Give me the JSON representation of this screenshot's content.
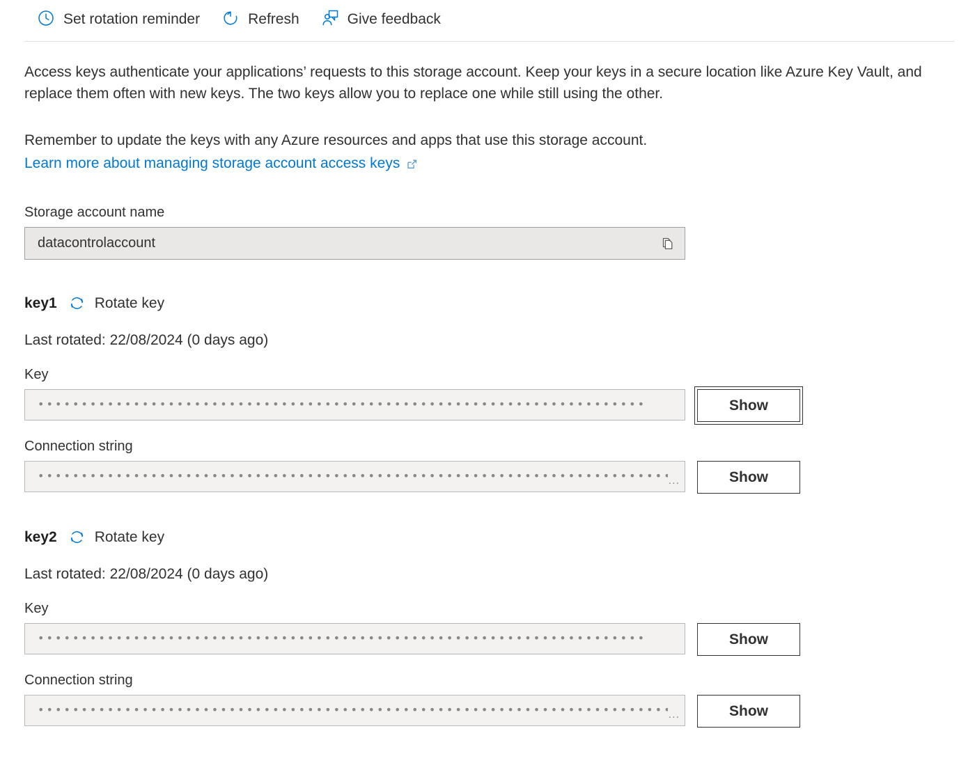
{
  "toolbar": {
    "commands": [
      {
        "label": "Set rotation reminder",
        "icon": "clock-icon"
      },
      {
        "label": "Refresh",
        "icon": "refresh-icon"
      },
      {
        "label": "Give feedback",
        "icon": "feedback-person-icon"
      }
    ]
  },
  "description": {
    "paragraph1": "Access keys authenticate your applications’ requests to this storage account. Keep your keys in a secure location like Azure Key Vault, and replace them often with new keys. The two keys allow you to replace one while still using the other.",
    "paragraph2": "Remember to update the keys with any Azure resources and apps that use this storage account.",
    "link_text": "Learn more about managing storage account access keys",
    "link_icon": "external-link-icon"
  },
  "storage_account": {
    "label": "Storage account name",
    "value": "datacontrolaccount",
    "copy_icon": "copy-icon"
  },
  "keys": [
    {
      "name": "key1",
      "rotate_label": "Rotate key",
      "rotate_icon": "rotate-icon",
      "last_rotated": "Last rotated: 22/08/2024 (0 days ago)",
      "key_label": "Key",
      "key_value_masked": "••••••••••••••••••••••••••••••••••••••••••••••••••••••••••••••••••••••••••••••••••••••••••••••••••••••••••••••••",
      "key_show_label": "Show",
      "key_show_focused": true,
      "connection_label": "Connection string",
      "connection_value_masked": "••••••••••••••••••••••••••••••••••••••••••••••••••••••••••••••••••••••••••••••••••••••••••••••••••••••••••••••••••••••••",
      "connection_truncation": "...",
      "connection_show_label": "Show",
      "connection_show_focused": false
    },
    {
      "name": "key2",
      "rotate_label": "Rotate key",
      "rotate_icon": "rotate-icon",
      "last_rotated": "Last rotated: 22/08/2024 (0 days ago)",
      "key_label": "Key",
      "key_value_masked": "••••••••••••••••••••••••••••••••••••••••••••••••••••••••••••••••••••••••••••••••••••••••••••••••••••••••••••••••",
      "key_show_label": "Show",
      "key_show_focused": false,
      "connection_label": "Connection string",
      "connection_value_masked": "••••••••••••••••••••••••••••••••••••••••••••••••••••••••••••••••••••••••••••••••••••••••••••••••••••••••••••••••••••••••",
      "connection_truncation": "...",
      "connection_show_label": "Show",
      "connection_show_focused": false
    }
  ],
  "colors": {
    "accent": "#0078d4",
    "text": "#323130",
    "field_bg": "#e9e8e7",
    "readonly_bg": "#f3f2f1",
    "border": "#a19f9d",
    "divider": "#e1dfdd"
  }
}
